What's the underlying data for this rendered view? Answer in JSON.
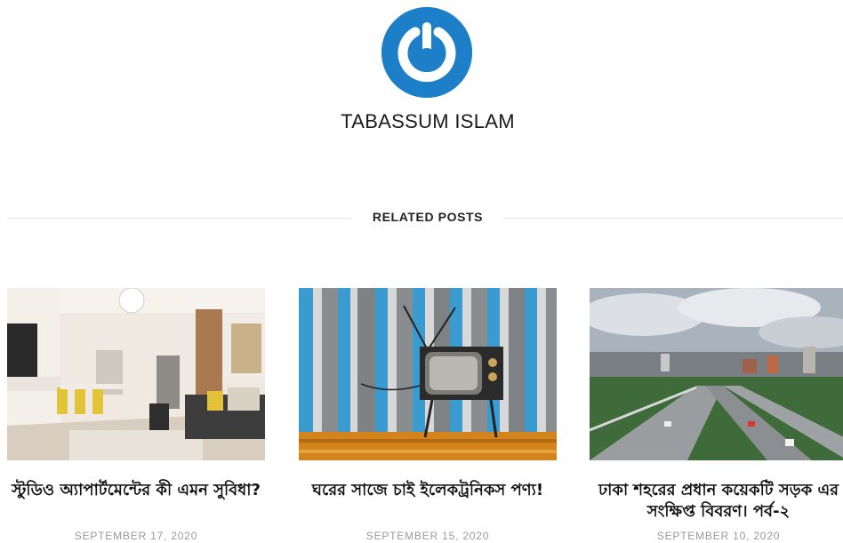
{
  "author": {
    "name": "TABASSUM ISLAM",
    "avatar_icon": "power-logo-icon",
    "avatar_color": "#1c7fc7"
  },
  "related": {
    "heading": "RELATED POSTS",
    "posts": [
      {
        "title": "স্টুডিও অ্যাপার্টমেন্টের কী এমন সুবিধা?",
        "date": "SEPTEMBER 17, 2020",
        "image": "living-room-image"
      },
      {
        "title": "ঘরের সাজে চাই ইলেকট্রনিকস পণ্য!",
        "date": "SEPTEMBER 15, 2020",
        "image": "retro-tv-image"
      },
      {
        "title": "ঢাকা শহরের প্রধান কয়েকটি সড়ক এর সংক্ষিপ্ত বিবরণ। পর্ব-২",
        "date": "SEPTEMBER 10, 2020",
        "image": "city-road-image"
      }
    ]
  }
}
